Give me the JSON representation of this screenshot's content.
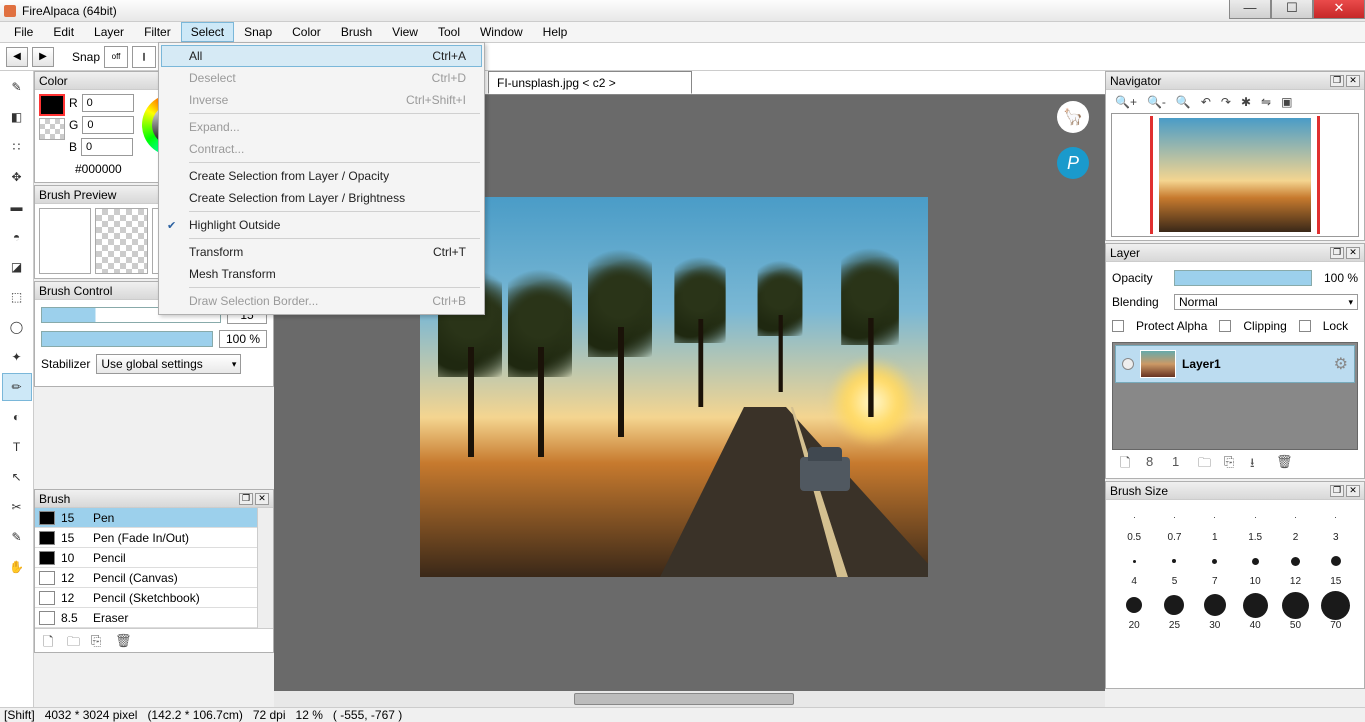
{
  "title": "FireAlpaca (64bit)",
  "menu": [
    "File",
    "Edit",
    "Layer",
    "Filter",
    "Select",
    "Snap",
    "Color",
    "Brush",
    "View",
    "Tool",
    "Window",
    "Help"
  ],
  "menu_open_index": 4,
  "dropdown": {
    "items": [
      {
        "label": "All",
        "shortcut": "Ctrl+A",
        "hl": true
      },
      {
        "label": "Deselect",
        "shortcut": "Ctrl+D",
        "dis": true
      },
      {
        "label": "Inverse",
        "shortcut": "Ctrl+Shift+I",
        "dis": true
      },
      {
        "sep": true
      },
      {
        "label": "Expand...",
        "dis": true
      },
      {
        "label": "Contract...",
        "dis": true
      },
      {
        "sep": true
      },
      {
        "label": "Create Selection from Layer / Opacity"
      },
      {
        "label": "Create Selection from Layer / Brightness"
      },
      {
        "sep": true
      },
      {
        "label": "Highlight Outside",
        "check": true
      },
      {
        "sep": true
      },
      {
        "label": "Transform",
        "shortcut": "Ctrl+T"
      },
      {
        "label": "Mesh Transform"
      },
      {
        "sep": true
      },
      {
        "label": "Draw Selection Border...",
        "shortcut": "Ctrl+B",
        "dis": true
      }
    ]
  },
  "snap": {
    "label": "Snap",
    "off": "off"
  },
  "tab": "FI-unsplash.jpg < c2 >",
  "color": {
    "title": "Color",
    "r_label": "R",
    "g_label": "G",
    "b_label": "B",
    "r": "0",
    "g": "0",
    "b": "0",
    "hex": "#000000"
  },
  "brush_preview": {
    "title": "Brush Preview"
  },
  "brush_control": {
    "title": "Brush Control",
    "size": "15",
    "opacity": "100 %",
    "stabilizer": "Stabilizer",
    "stab_val": "Use global settings"
  },
  "brush": {
    "title": "Brush",
    "items": [
      {
        "size": "15",
        "name": "Pen",
        "sel": true,
        "dark": true
      },
      {
        "size": "15",
        "name": "Pen (Fade In/Out)",
        "dark": true
      },
      {
        "size": "10",
        "name": "Pencil",
        "dark": true
      },
      {
        "size": "12",
        "name": "Pencil (Canvas)",
        "dark": false
      },
      {
        "size": "12",
        "name": "Pencil (Sketchbook)",
        "dark": false
      },
      {
        "size": "8.5",
        "name": "Eraser",
        "dark": false
      }
    ]
  },
  "navigator": {
    "title": "Navigator"
  },
  "layer": {
    "title": "Layer",
    "opacity": "Opacity",
    "opacity_val": "100 %",
    "blending": "Blending",
    "blend_val": "Normal",
    "protect": "Protect Alpha",
    "clipping": "Clipping",
    "lock": "Lock",
    "layer1": "Layer1"
  },
  "brush_size": {
    "title": "Brush Size",
    "labels": [
      "0.5",
      "0.7",
      "1",
      "1.5",
      "2",
      "3",
      "4",
      "5",
      "7",
      "10",
      "12",
      "15",
      "20",
      "25",
      "30",
      "40",
      "50",
      "70"
    ],
    "dots": [
      1,
      1,
      1,
      1,
      1,
      1,
      3,
      4,
      5,
      7,
      9,
      10,
      16,
      20,
      22,
      25,
      27,
      29
    ]
  },
  "status": {
    "shift": "[Shift]",
    "dim": "4032 * 3024 pixel",
    "phys": "(142.2 * 106.7cm)",
    "dpi": "72 dpi",
    "zoom": "12 %",
    "pos": "( -555, -767 )"
  }
}
